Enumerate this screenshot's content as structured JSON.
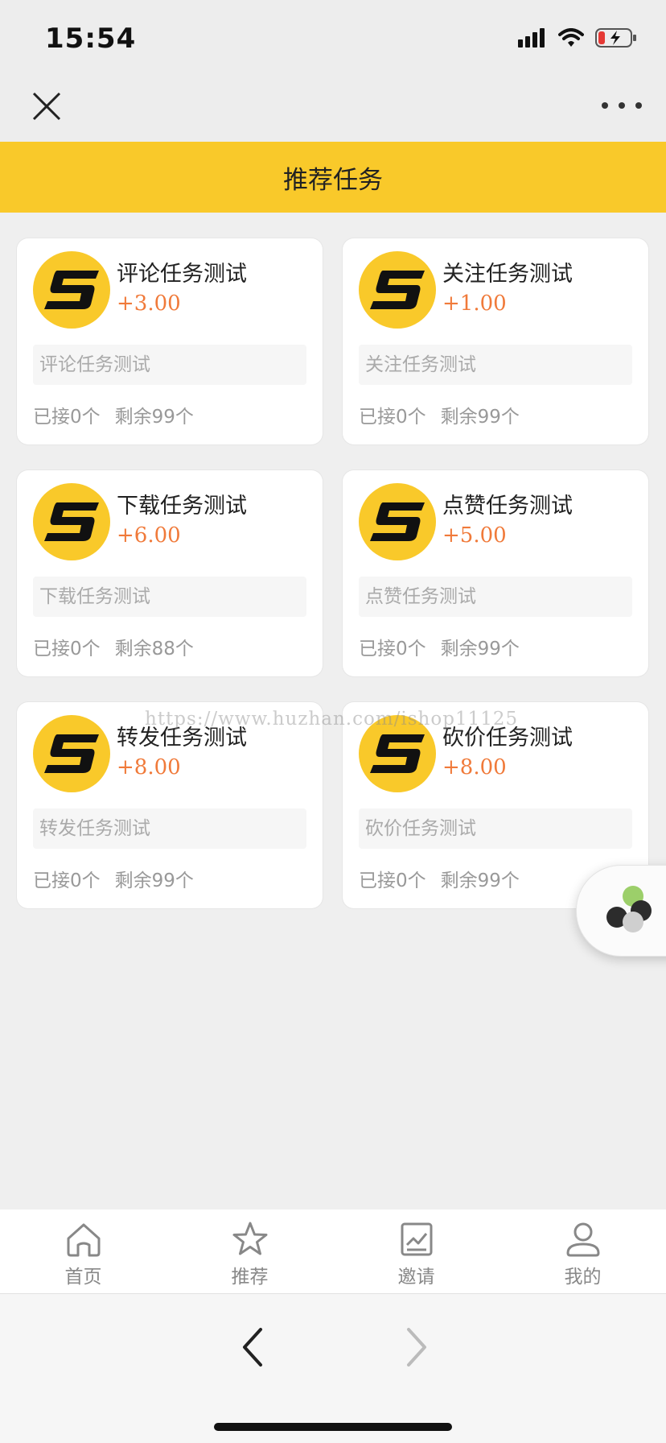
{
  "status_bar": {
    "time": "15:54"
  },
  "header": {
    "title": "推荐任务"
  },
  "tasks": [
    {
      "title": "评论任务测试",
      "reward": "+3.00",
      "desc": "评论任务测试",
      "taken": "已接0个",
      "remaining": "剩余99个"
    },
    {
      "title": "关注任务测试",
      "reward": "+1.00",
      "desc": "关注任务测试",
      "taken": "已接0个",
      "remaining": "剩余99个"
    },
    {
      "title": "下载任务测试",
      "reward": "+6.00",
      "desc": "下载任务测试",
      "taken": "已接0个",
      "remaining": "剩余88个"
    },
    {
      "title": "点赞任务测试",
      "reward": "+5.00",
      "desc": "点赞任务测试",
      "taken": "已接0个",
      "remaining": "剩余99个"
    },
    {
      "title": "转发任务测试",
      "reward": "+8.00",
      "desc": "转发任务测试",
      "taken": "已接0个",
      "remaining": "剩余99个"
    },
    {
      "title": "砍价任务测试",
      "reward": "+8.00",
      "desc": "砍价任务测试",
      "taken": "已接0个",
      "remaining": "剩余99个"
    }
  ],
  "watermark": "https://www.huzhan.com/ishop11125",
  "tab_bar": {
    "items": [
      {
        "label": "首页",
        "icon": "home-icon"
      },
      {
        "label": "推荐",
        "icon": "star-icon"
      },
      {
        "label": "邀请",
        "icon": "invite-icon"
      },
      {
        "label": "我的",
        "icon": "user-icon"
      }
    ]
  },
  "colors": {
    "brand_yellow": "#f9c92a",
    "reward_orange": "#f07a3a",
    "tab_inactive": "#888888"
  }
}
